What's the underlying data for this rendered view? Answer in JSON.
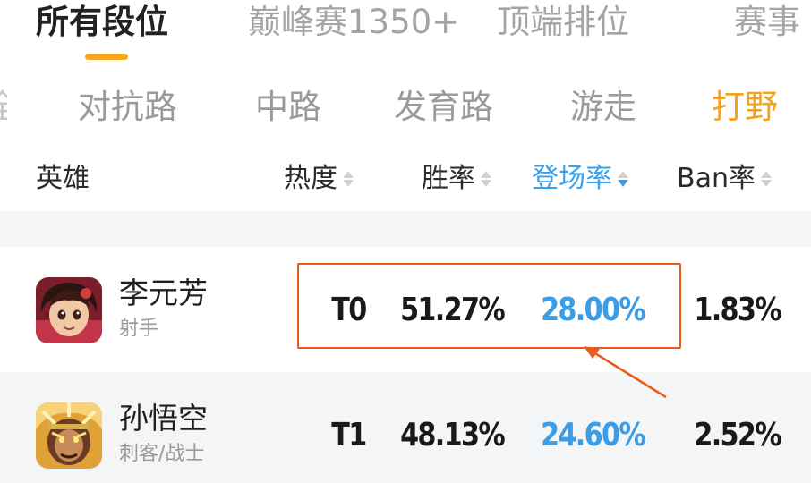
{
  "top_tabs": [
    {
      "label": "所有段位",
      "active": true
    },
    {
      "label": "巅峰赛1350+",
      "active": false
    },
    {
      "label": "顶端排位",
      "active": false
    },
    {
      "label": "赛事",
      "active": false
    }
  ],
  "position_tabs": [
    {
      "label": "全部",
      "active": false
    },
    {
      "label": "对抗路",
      "active": false
    },
    {
      "label": "中路",
      "active": false
    },
    {
      "label": "发育路",
      "active": false
    },
    {
      "label": "游走",
      "active": false
    },
    {
      "label": "打野",
      "active": true
    }
  ],
  "columns": {
    "hero": "英雄",
    "heat": "热度",
    "win_rate": "胜率",
    "pick_rate": "登场率",
    "ban_rate": "Ban率"
  },
  "rows": [
    {
      "name": "李元芳",
      "role": "射手",
      "tier": "T0",
      "win_rate": "51.27%",
      "pick_rate": "28.00%",
      "ban_rate": "1.83%"
    },
    {
      "name": "孙悟空",
      "role": "刺客/战士",
      "tier": "T1",
      "win_rate": "48.13%",
      "pick_rate": "24.60%",
      "ban_rate": "2.52%"
    }
  ],
  "colors": {
    "accent_orange": "#f5a21c",
    "active_sort_blue": "#3aa0ea",
    "annotation_red": "#ea5a1c"
  },
  "icons": [
    "sort-arrows-icon",
    "hero-avatar-li-yuanfang",
    "hero-avatar-sun-wukong"
  ]
}
